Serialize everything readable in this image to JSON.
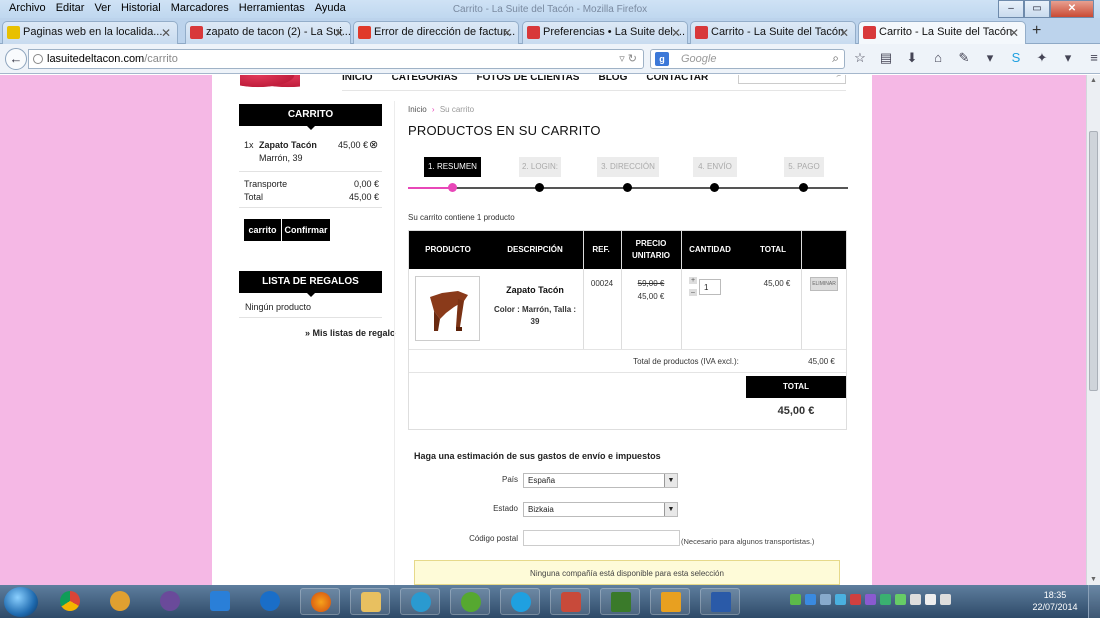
{
  "window": {
    "title": "Carrito - La Suite del Tacón - Mozilla Firefox",
    "controls": [
      "–",
      "▭",
      "✕"
    ]
  },
  "menu": [
    "Archivo",
    "Editar",
    "Ver",
    "Historial",
    "Marcadores",
    "Herramientas",
    "Ayuda"
  ],
  "tabs": [
    {
      "label": "Paginas web en la localida...",
      "fav": "#e8c000"
    },
    {
      "label": "zapato de tacon (2) - La Sui...",
      "fav": "#d8383a"
    },
    {
      "label": "Error de dirección de factur...",
      "fav": "#e03a2a"
    },
    {
      "label": "Preferencias • La Suite del ...",
      "fav": "#d8383a"
    },
    {
      "label": "Carrito - La Suite del Tacón",
      "fav": "#d8383a"
    },
    {
      "label": "Carrito - La Suite del Tacón",
      "fav": "#d8383a"
    }
  ],
  "nav": {
    "url_domain": "lasuitedeltacon.com",
    "url_path": "/carrito",
    "search_placeholder": "Google",
    "search_engine_icon": "g-icon"
  },
  "site": {
    "topnav": [
      "INICIO",
      "CATEGORIAS",
      "FOTOS DE CLIENTAS",
      "BLOG",
      "CONTACTAR"
    ]
  },
  "sidebar": {
    "cart_title": "CARRITO",
    "item_qty": "1x",
    "item_name": "Zapato Tacón",
    "item_variant": "Marrón, 39",
    "item_price": "45,00 €",
    "shipping_label": "Transporte",
    "shipping_value": "0,00 €",
    "total_label": "Total",
    "total_value": "45,00 €",
    "btn_cart": "carrito",
    "btn_confirm": "Confirmar",
    "gifts_title": "LISTA DE REGALOS",
    "gifts_empty": "Ningún producto",
    "gifts_link": "» Mis listas de regalo"
  },
  "main": {
    "breadcrumb_home": "Inicio",
    "breadcrumb_sep": "›",
    "breadcrumb_current": "Su carrito",
    "heading": "PRODUCTOS EN SU CARRITO",
    "steps": [
      "1. RESUMEN",
      "2. LOGIN:",
      "3. DIRECCIÓN",
      "4. ENVÍO",
      "5. PAGO"
    ],
    "summary_note": "Su carrito contiene 1 producto",
    "table_headers": {
      "product": "PRODUCTO",
      "description": "DESCRIPCIÓN",
      "ref": "REF.",
      "unit_price_1": "PRECIO",
      "unit_price_2": "UNITARIO",
      "quantity": "CANTIDAD",
      "total": "TOTAL"
    },
    "row": {
      "name": "Zapato Tacón",
      "attrs": "Color : Marrón, Talla :",
      "attrs2": "39",
      "ref": "00024",
      "old_price": "59,00 €",
      "price": "45,00 €",
      "qty": "1",
      "total": "45,00 €",
      "delete": "ELIMINAR"
    },
    "products_total_label": "Total de productos (IVA excl.):",
    "products_total_value": "45,00 €",
    "grand_total_label": "TOTAL",
    "grand_total_value": "45,00 €"
  },
  "shipping": {
    "title": "Haga una estimación de sus gastos de envío e impuestos",
    "country_label": "País",
    "country_value": "España",
    "state_label": "Estado",
    "state_value": "Bizkaia",
    "zip_label": "Código postal",
    "zip_hint": "(Necesario para algunos transportistas.)",
    "no_carrier": "Ninguna compañía está disponible para esta selección"
  },
  "taskbar": {
    "time": "18:35",
    "date": "22/07/2014"
  },
  "colors": {
    "page_bg": "#f5b8e5",
    "accent_pink": "#e847b8",
    "header_black": "#000000"
  }
}
